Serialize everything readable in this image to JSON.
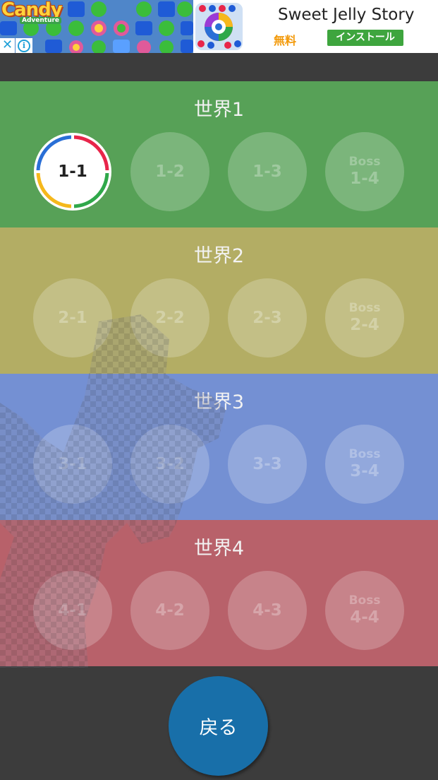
{
  "ad": {
    "logo_text": "Candy",
    "logo_sub": "Adventure",
    "close_glyph": "✕",
    "info_glyph": "i",
    "title": "Sweet Jelly Story",
    "price": "無料",
    "install_label": "インストール"
  },
  "worlds": [
    {
      "title": "世界1",
      "color": "#57a157",
      "stages": [
        {
          "label": "1-1",
          "boss": "",
          "unlocked": true
        },
        {
          "label": "1-2",
          "boss": "",
          "unlocked": false
        },
        {
          "label": "1-3",
          "boss": "",
          "unlocked": false
        },
        {
          "label": "1-4",
          "boss": "Boss",
          "unlocked": false
        }
      ]
    },
    {
      "title": "世界2",
      "color": "#b3ad64",
      "stages": [
        {
          "label": "2-1",
          "boss": "",
          "unlocked": false
        },
        {
          "label": "2-2",
          "boss": "",
          "unlocked": false
        },
        {
          "label": "2-3",
          "boss": "",
          "unlocked": false
        },
        {
          "label": "2-4",
          "boss": "Boss",
          "unlocked": false
        }
      ]
    },
    {
      "title": "世界3",
      "color": "#7490d3",
      "stages": [
        {
          "label": "3-1",
          "boss": "",
          "unlocked": false
        },
        {
          "label": "3-2",
          "boss": "",
          "unlocked": false
        },
        {
          "label": "3-3",
          "boss": "",
          "unlocked": false
        },
        {
          "label": "3-4",
          "boss": "Boss",
          "unlocked": false
        }
      ]
    },
    {
      "title": "世界4",
      "color": "#b8616a",
      "stages": [
        {
          "label": "4-1",
          "boss": "",
          "unlocked": false
        },
        {
          "label": "4-2",
          "boss": "",
          "unlocked": false
        },
        {
          "label": "4-3",
          "boss": "",
          "unlocked": false
        },
        {
          "label": "4-4",
          "boss": "Boss",
          "unlocked": false
        }
      ]
    }
  ],
  "back_button": {
    "label": "戻る",
    "color": "#186fa9"
  },
  "active_ring_colors": [
    "#e8254a",
    "#2a6fd6",
    "#2fa84a",
    "#f5b81c"
  ]
}
